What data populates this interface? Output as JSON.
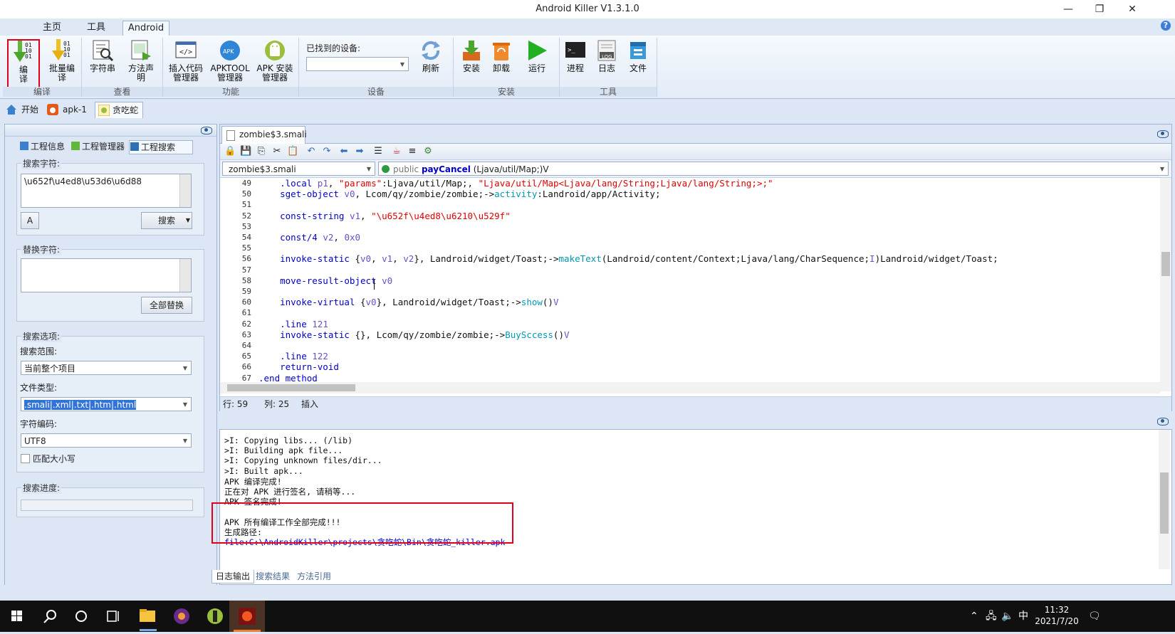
{
  "window": {
    "title": "Android Killer V1.3.1.0",
    "minimize": "—",
    "restore": "❐",
    "close": "✕"
  },
  "menu_tabs": [
    "主页",
    "工具",
    "Android"
  ],
  "ribbon": {
    "groups": [
      {
        "label": "编译",
        "buttons": [
          "编译",
          "批量编译"
        ]
      },
      {
        "label": "查看",
        "buttons": [
          "字符串",
          "方法声明"
        ]
      },
      {
        "label": "功能",
        "buttons": [
          "插入代码管理器",
          "APKTOOL管理器",
          "APK 安装管理器"
        ]
      },
      {
        "label": "设备",
        "device_label": "已找到的设备:",
        "buttons": [
          "刷新"
        ]
      },
      {
        "label": "安装",
        "buttons": [
          "安装",
          "卸载",
          "运行"
        ]
      },
      {
        "label": "工具",
        "buttons": [
          "进程",
          "日志",
          "文件"
        ]
      }
    ],
    "btn": {
      "compile": [
        "编",
        "译"
      ],
      "batch": [
        "批量编",
        "译"
      ],
      "strings": [
        "字符串"
      ],
      "method": [
        "方法声",
        "明"
      ],
      "insert": [
        "插入代码",
        "管理器"
      ],
      "apktool": [
        "APKTOOL",
        "管理器"
      ],
      "apkinstall": [
        "APK 安装",
        "管理器"
      ],
      "refresh": [
        "刷新"
      ],
      "install": [
        "安装"
      ],
      "uninstall": [
        "卸载"
      ],
      "run": [
        "运行"
      ],
      "process": [
        "进程"
      ],
      "log": [
        "日志"
      ],
      "file": [
        "文件"
      ]
    },
    "log_icon_text": "LOG"
  },
  "doc_tabs": [
    "开始",
    "apk-1",
    "贪吃蛇"
  ],
  "left_panel": {
    "tabs": [
      "工程信息",
      "工程管理器",
      "工程搜索"
    ],
    "search_label": "搜索字符:",
    "search_value": "\\u652f\\u4ed8\\u53d6\\u6d88",
    "search_button": "搜索",
    "replace_label": "替换字符:",
    "replace_all_button": "全部替换",
    "options_label": "搜索选项:",
    "scope_label": "搜索范围:",
    "scope_value": "当前整个项目",
    "filetype_label": "文件类型:",
    "filetype_value": ".smali|.xml|.txt|.htm|.html",
    "encoding_label": "字符编码:",
    "encoding_value": "UTF8",
    "match_case": "匹配大小写",
    "progress_label": "搜索进度:"
  },
  "editor": {
    "tab": "zombie$3.smali",
    "file_select": "zombie$3.smali",
    "method_modifier": "public",
    "method_name": "payCancel",
    "method_sig": "(Ljava/util/Map;)V",
    "lines": [
      {
        "n": "49",
        "parts": [
          [
            "kw",
            "    .local "
          ],
          [
            "reg",
            "p1"
          ],
          [
            "typ",
            ", "
          ],
          [
            "str",
            "\"params\""
          ],
          [
            "typ",
            ":Ljava/util/Map;, "
          ],
          [
            "str",
            "\"Ljava/util/Map<Ljava/lang/String;Ljava/lang/String;>;\""
          ]
        ]
      },
      {
        "n": "50",
        "parts": [
          [
            "kw",
            "    sget-object "
          ],
          [
            "reg",
            "v0"
          ],
          [
            "typ",
            ", Lcom/qy/zombie/zombie;->"
          ],
          [
            "mth",
            "activity"
          ],
          [
            "typ",
            ":Landroid/app/Activity;"
          ]
        ]
      },
      {
        "n": "51",
        "parts": []
      },
      {
        "n": "52",
        "parts": [
          [
            "kw",
            "    const-string "
          ],
          [
            "reg",
            "v1"
          ],
          [
            "typ",
            ", "
          ],
          [
            "str",
            "\"\\u652f\\u4ed8\\u6210\\u529f\""
          ]
        ]
      },
      {
        "n": "53",
        "parts": []
      },
      {
        "n": "54",
        "parts": [
          [
            "kw",
            "    const/4 "
          ],
          [
            "reg",
            "v2"
          ],
          [
            "typ",
            ", "
          ],
          [
            "reg",
            "0x0"
          ]
        ]
      },
      {
        "n": "55",
        "parts": []
      },
      {
        "n": "56",
        "parts": [
          [
            "kw",
            "    invoke-static "
          ],
          [
            "typ",
            "{"
          ],
          [
            "reg",
            "v0"
          ],
          [
            "typ",
            ", "
          ],
          [
            "reg",
            "v1"
          ],
          [
            "typ",
            ", "
          ],
          [
            "reg",
            "v2"
          ],
          [
            "typ",
            "}, Landroid/widget/Toast;->"
          ],
          [
            "mth",
            "makeText"
          ],
          [
            "typ",
            "(Landroid/content/Context;Ljava/lang/CharSequence;"
          ],
          [
            "reg",
            "I"
          ],
          [
            "typ",
            ")Landroid/widget/Toast;"
          ]
        ]
      },
      {
        "n": "57",
        "parts": []
      },
      {
        "n": "58",
        "parts": [
          [
            "kw",
            "    move-result-object "
          ],
          [
            "reg",
            "v0"
          ]
        ]
      },
      {
        "n": "59",
        "parts": []
      },
      {
        "n": "60",
        "parts": [
          [
            "kw",
            "    invoke-virtual "
          ],
          [
            "typ",
            "{"
          ],
          [
            "reg",
            "v0"
          ],
          [
            "typ",
            "}, Landroid/widget/Toast;->"
          ],
          [
            "mth",
            "show"
          ],
          [
            "typ",
            "()"
          ],
          [
            "reg",
            "V"
          ]
        ]
      },
      {
        "n": "61",
        "parts": []
      },
      {
        "n": "62",
        "parts": [
          [
            "kw",
            "    .line "
          ],
          [
            "reg",
            "121"
          ]
        ]
      },
      {
        "n": "63",
        "parts": [
          [
            "kw",
            "    invoke-static "
          ],
          [
            "typ",
            "{}, Lcom/qy/zombie/zombie;->"
          ],
          [
            "mth",
            "BuySccess"
          ],
          [
            "typ",
            "()"
          ],
          [
            "reg",
            "V"
          ]
        ]
      },
      {
        "n": "64",
        "parts": []
      },
      {
        "n": "65",
        "parts": [
          [
            "kw",
            "    .line "
          ],
          [
            "reg",
            "122"
          ]
        ]
      },
      {
        "n": "66",
        "parts": [
          [
            "kw",
            "    return-void"
          ]
        ]
      },
      {
        "n": "67",
        "parts": [
          [
            "kw",
            ".end method"
          ]
        ]
      }
    ],
    "status": {
      "row": "行: 59",
      "col": "列: 25",
      "mode": "插入"
    }
  },
  "output": {
    "lines": [
      ">I: Copying libs... (/lib)",
      ">I: Building apk file...",
      ">I: Copying unknown files/dir...",
      ">I: Built apk...",
      "APK 编译完成!",
      "正在对 APK 进行签名, 请稍等...",
      "APK 签名完成!",
      "",
      "APK 所有编译工作全部完成!!!",
      "生成路径:"
    ],
    "path_link": "file:C:\\AndroidKiller\\projects\\贪吃蛇\\Bin\\贪吃蛇_killer.apk",
    "tabs": [
      "日志输出",
      "搜索结果",
      "方法引用"
    ]
  },
  "taskbar": {
    "time": "11:32",
    "date": "2021/7/20",
    "ime": "中"
  },
  "colors": {
    "highlight": "#e0001b",
    "keyword": "#0000c8",
    "string": "#e00000",
    "register": "#6e4ec9",
    "method": "#0098b0",
    "link": "#0000d0"
  }
}
